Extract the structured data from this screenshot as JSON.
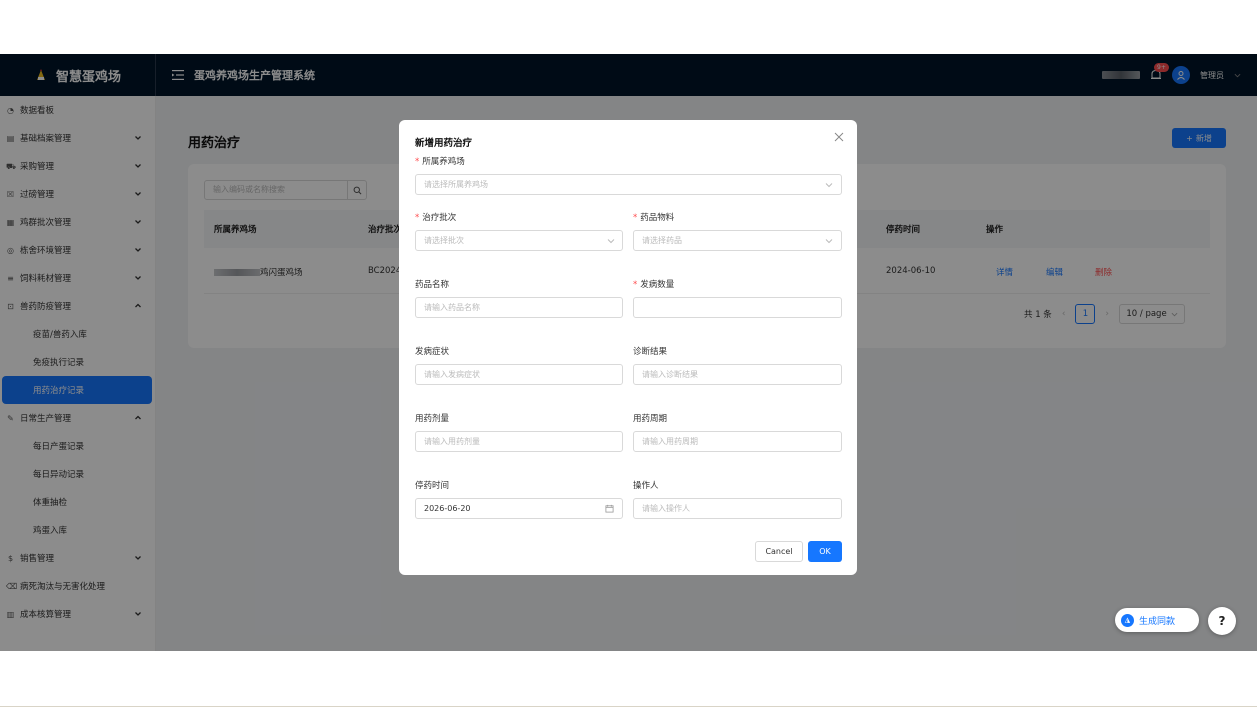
{
  "header": {
    "brand": "智慧蛋鸡场",
    "system_title": "蛋鸡养鸡场生产管理系统",
    "notification_count": "9+",
    "user_name": "管理员"
  },
  "sidebar": {
    "items": [
      {
        "label": "数据看板",
        "icon": "dashboard-icon",
        "expandable": false
      },
      {
        "label": "基础档案管理",
        "icon": "archive-icon",
        "expandable": true,
        "expanded": false
      },
      {
        "label": "采购管理",
        "icon": "truck-icon",
        "expandable": true,
        "expanded": false
      },
      {
        "label": "过磅管理",
        "icon": "scale-icon",
        "expandable": true,
        "expanded": false
      },
      {
        "label": "鸡群批次管理",
        "icon": "grid-icon",
        "expandable": true,
        "expanded": false
      },
      {
        "label": "栋舍环境管理",
        "icon": "location-icon",
        "expandable": true,
        "expanded": false
      },
      {
        "label": "饲料耗材管理",
        "icon": "list-icon",
        "expandable": true,
        "expanded": false
      },
      {
        "label": "兽药防疫管理",
        "icon": "medicine-icon",
        "expandable": true,
        "expanded": true
      },
      {
        "label": "疫苗/兽药入库",
        "sub": true
      },
      {
        "label": "免疫执行记录",
        "sub": true
      },
      {
        "label": "用药治疗记录",
        "sub": true,
        "active": true
      },
      {
        "label": "日常生产管理",
        "icon": "edit-icon",
        "expandable": true,
        "expanded": true
      },
      {
        "label": "每日产蛋记录",
        "sub": true
      },
      {
        "label": "每日异动记录",
        "sub": true
      },
      {
        "label": "体重抽检",
        "sub": true
      },
      {
        "label": "鸡蛋入库",
        "sub": true
      },
      {
        "label": "销售管理",
        "icon": "dollar-icon",
        "expandable": true,
        "expanded": false
      },
      {
        "label": "病死淘汰与无害化处理",
        "icon": "trash-icon",
        "expandable": false
      },
      {
        "label": "成本核算管理",
        "icon": "bar-chart-icon",
        "expandable": true,
        "expanded": false
      }
    ]
  },
  "page": {
    "title": "用药治疗",
    "add_button": "新增",
    "search_placeholder": "输入编码或名称搜索",
    "columns": [
      "所属养鸡场",
      "治疗批次",
      "停药时间",
      "操作"
    ],
    "rows": [
      {
        "farm_suffix": "鸡闪蛋鸡场",
        "batch": "BC2024",
        "stop_date": "2024-06-10",
        "actions": [
          "详情",
          "编辑",
          "删除"
        ]
      }
    ],
    "pagination": {
      "total": "共 1 条",
      "current": "1",
      "page_size": "10 / page"
    }
  },
  "modal": {
    "title": "新增用药治疗",
    "fields": {
      "farm": {
        "label": "所属养鸡场",
        "required": true,
        "placeholder": "请选择所属养鸡场"
      },
      "batch": {
        "label": "治疗批次",
        "required": true,
        "placeholder": "请选择批次"
      },
      "material": {
        "label": "药品物料",
        "required": true,
        "placeholder": "请选择药品"
      },
      "drug_name": {
        "label": "药品名称",
        "required": false,
        "placeholder": "请输入药品名称"
      },
      "sick_count": {
        "label": "发病数量",
        "required": true,
        "placeholder": ""
      },
      "symptom": {
        "label": "发病症状",
        "required": false,
        "placeholder": "请输入发病症状"
      },
      "diagnosis": {
        "label": "诊断结果",
        "required": false,
        "placeholder": "请输入诊断结果"
      },
      "dosage": {
        "label": "用药剂量",
        "required": false,
        "placeholder": "请输入用药剂量"
      },
      "cycle": {
        "label": "用药周期",
        "required": false,
        "placeholder": "请输入用药周期"
      },
      "stop_time": {
        "label": "停药时间",
        "required": false,
        "value": "2026-06-20"
      },
      "operator": {
        "label": "操作人",
        "required": false,
        "placeholder": "请输入操作人"
      }
    },
    "cancel_label": "Cancel",
    "ok_label": "OK"
  },
  "floating": {
    "generate_label": "生成同款",
    "help_label": "?"
  },
  "colors": {
    "primary": "#1677ff",
    "header_bg": "#001529",
    "danger": "#ff4d4f"
  }
}
